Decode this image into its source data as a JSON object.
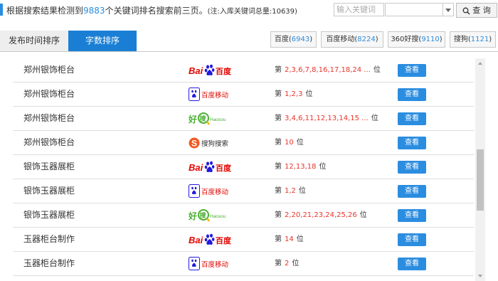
{
  "summary": {
    "prefix": "根据搜索结果检测到",
    "count": "9883",
    "suffix": "个关键词排名搜索前三页。",
    "note": "(注:入库关键词总量:10639)"
  },
  "search": {
    "placeholder": "输入关键词",
    "select_value": "",
    "button_label": "查 询"
  },
  "tabs": [
    {
      "label": "发布时间排序",
      "active": false
    },
    {
      "label": "字数排序",
      "active": true
    }
  ],
  "engines": [
    {
      "name": "百度",
      "count": "6943"
    },
    {
      "name": "百度移动",
      "count": "8224"
    },
    {
      "name": "360好搜",
      "count": "9110"
    },
    {
      "name": "搜狗",
      "count": "1121"
    }
  ],
  "rank_prefix": "第",
  "rank_suffix": "位",
  "view_label": "查看",
  "rows": [
    {
      "keyword": "郑州银饰柜台",
      "engine": "baidu",
      "positions": "2,3,6,7,8,16,17,18,24 ..."
    },
    {
      "keyword": "郑州银饰柜台",
      "engine": "baidu-mobile",
      "positions": "1,2,3"
    },
    {
      "keyword": "郑州银饰柜台",
      "engine": "haosou",
      "positions": "3,4,6,11,12,13,14,15 ..."
    },
    {
      "keyword": "郑州银饰柜台",
      "engine": "sogou",
      "positions": "10"
    },
    {
      "keyword": "银饰玉器展柜",
      "engine": "baidu",
      "positions": "12,13,18"
    },
    {
      "keyword": "银饰玉器展柜",
      "engine": "baidu-mobile",
      "positions": "1,2"
    },
    {
      "keyword": "银饰玉器展柜",
      "engine": "haosou",
      "positions": "2,20,21,23,24,25,26"
    },
    {
      "keyword": "玉器柜台制作",
      "engine": "baidu",
      "positions": "14"
    },
    {
      "keyword": "玉器柜台制作",
      "engine": "baidu-mobile",
      "positions": "2"
    }
  ],
  "logo_text": {
    "baidu": {
      "latin": "Bai",
      "cn": "百度"
    },
    "baidu-mobile": {
      "cn": "百度移动"
    },
    "haosou": {
      "cn": "好",
      "cn2": "搜",
      "latin": "Haosou"
    },
    "sogou": {
      "cn": "搜狗搜索"
    }
  },
  "colors": {
    "accent": "#2b8de0",
    "active_tab": "#1a7fd4",
    "rank_number": "#e8342b",
    "baidu_red": "#e10601",
    "baidu_blue": "#2319dc",
    "haosou_green": "#4cb035",
    "sogou_orange": "#f05a24"
  }
}
